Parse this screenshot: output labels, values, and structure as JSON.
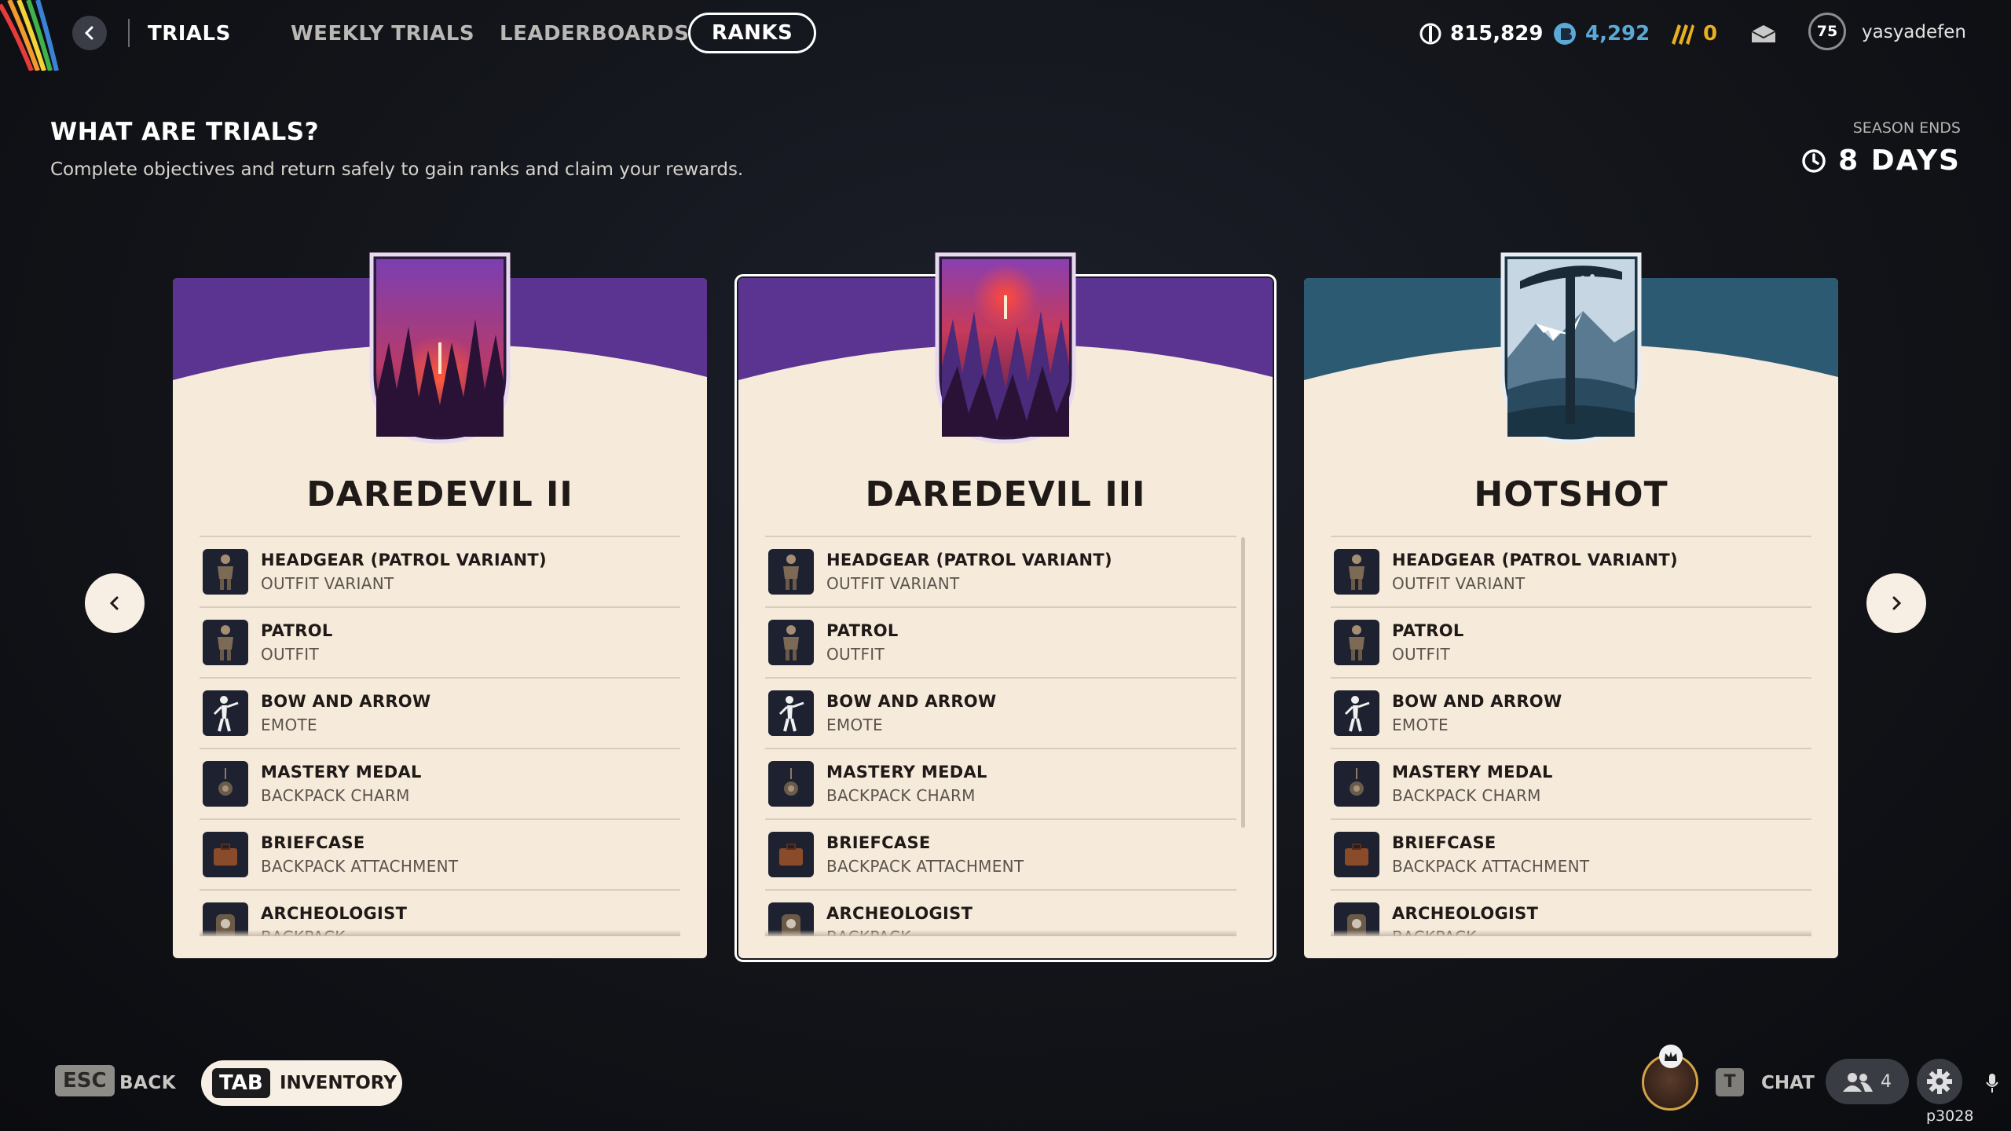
{
  "nav": {
    "tabs": [
      {
        "label": "TRIALS"
      },
      {
        "label": "WEEKLY TRIALS"
      },
      {
        "label": "LEADERBOARDS"
      },
      {
        "label": "RANKS"
      }
    ]
  },
  "currencies": [
    {
      "icon": "coin-icon",
      "value": "815,829",
      "color": "#ffffff"
    },
    {
      "icon": "token-icon",
      "value": "4,292",
      "color": "#5aa9d6"
    },
    {
      "icon": "ticket-icon",
      "value": "0",
      "color": "#e8b021"
    }
  ],
  "profile": {
    "level": "75",
    "username": "yasyadefen"
  },
  "intro": {
    "title": "WHAT ARE TRIALS?",
    "description": "Complete objectives and return safely to gain ranks and claim your rewards."
  },
  "season": {
    "label": "SEASON ENDS",
    "value": "8 DAYS"
  },
  "cards": [
    {
      "title": "DAREDEVIL II",
      "header_color": "#5b3391",
      "selected": false,
      "rewards": [
        {
          "name": "HEADGEAR (PATROL VARIANT)",
          "type": "OUTFIT VARIANT",
          "icon": "outfit-figure-icon"
        },
        {
          "name": "PATROL",
          "type": "OUTFIT",
          "icon": "outfit-figure-icon"
        },
        {
          "name": "BOW AND ARROW",
          "type": "EMOTE",
          "icon": "emote-figure-icon"
        },
        {
          "name": "MASTERY MEDAL",
          "type": "BACKPACK CHARM",
          "icon": "medal-charm-icon"
        },
        {
          "name": "BRIEFCASE",
          "type": "BACKPACK ATTACHMENT",
          "icon": "briefcase-icon"
        },
        {
          "name": "ARCHEOLOGIST",
          "type": "BACKPACK",
          "icon": "backpack-icon"
        }
      ]
    },
    {
      "title": "DAREDEVIL III",
      "header_color": "#5b3391",
      "selected": true,
      "rewards": [
        {
          "name": "HEADGEAR (PATROL VARIANT)",
          "type": "OUTFIT VARIANT",
          "icon": "outfit-figure-icon"
        },
        {
          "name": "PATROL",
          "type": "OUTFIT",
          "icon": "outfit-figure-icon"
        },
        {
          "name": "BOW AND ARROW",
          "type": "EMOTE",
          "icon": "emote-figure-icon"
        },
        {
          "name": "MASTERY MEDAL",
          "type": "BACKPACK CHARM",
          "icon": "medal-charm-icon"
        },
        {
          "name": "BRIEFCASE",
          "type": "BACKPACK ATTACHMENT",
          "icon": "briefcase-icon"
        },
        {
          "name": "ARCHEOLOGIST",
          "type": "BACKPACK",
          "icon": "backpack-icon"
        }
      ]
    },
    {
      "title": "HOTSHOT",
      "header_color": "#2c5a72",
      "selected": false,
      "rewards": [
        {
          "name": "HEADGEAR (PATROL VARIANT)",
          "type": "OUTFIT VARIANT",
          "icon": "outfit-figure-icon"
        },
        {
          "name": "PATROL",
          "type": "OUTFIT",
          "icon": "outfit-figure-icon"
        },
        {
          "name": "BOW AND ARROW",
          "type": "EMOTE",
          "icon": "emote-figure-icon"
        },
        {
          "name": "MASTERY MEDAL",
          "type": "BACKPACK CHARM",
          "icon": "medal-charm-icon"
        },
        {
          "name": "BRIEFCASE",
          "type": "BACKPACK ATTACHMENT",
          "icon": "briefcase-icon"
        },
        {
          "name": "ARCHEOLOGIST",
          "type": "BACKPACK",
          "icon": "backpack-icon"
        }
      ]
    }
  ],
  "footer": {
    "back_key": "ESC",
    "back_label": "BACK",
    "inventory_key": "TAB",
    "inventory_label": "INVENTORY",
    "chat_key": "T",
    "chat_label": "CHAT",
    "party_count": "4",
    "build": "p3028"
  },
  "colors": {
    "card_bg": "#f6eadb",
    "purple_header": "#5b3391",
    "teal_header": "#2c5a72",
    "accent_blue": "#5aa9d6",
    "accent_gold": "#e8b021"
  }
}
